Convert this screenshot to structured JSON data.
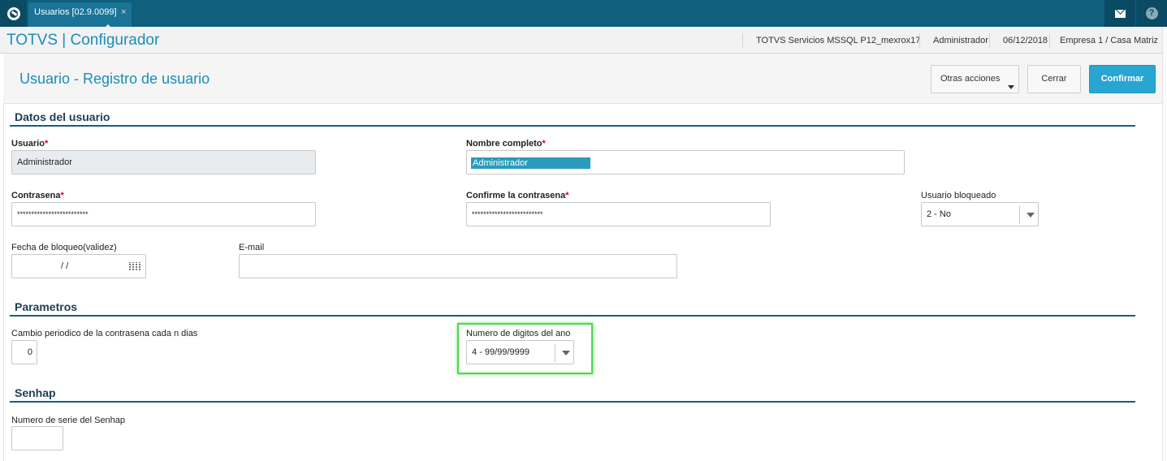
{
  "topbar": {
    "tab_label": "Usuarios [02.9.0099]",
    "tab_close": "×",
    "help_glyph": "?"
  },
  "header": {
    "brand": "TOTVS | Configurador",
    "server": "TOTVS Servicios MSSQL P12_mexrox17",
    "user": "Administrador",
    "date": "06/12/2018",
    "company": "Empresa 1 / Casa Matriz"
  },
  "page": {
    "title": "Usuario - Registro de usuario",
    "btn_more": "Otras acciones",
    "btn_close": "Cerrar",
    "btn_confirm": "Confirmar"
  },
  "user_section": {
    "title": "Datos del usuario",
    "usuario_label": "Usuario",
    "usuario_value": "Administrador",
    "nombre_label": "Nombre completo",
    "nombre_value": "Administrador",
    "contrasena_label": "Contrasena",
    "contrasena_value": "*************************",
    "confirme_label": "Confirme la contrasena",
    "confirme_value": "*************************",
    "bloqueado_label": "Usuario bloqueado",
    "bloqueado_value": "2 - No",
    "fecha_label": "Fecha de bloqueo(validez)",
    "fecha_value": "/ /",
    "email_label": "E-mail",
    "email_value": "",
    "required_mark": "*"
  },
  "param_section": {
    "title": "Parametros",
    "cambio_label": "Cambio periodico de la contrasena cada n dias",
    "cambio_value": "0",
    "digitos_label": "Numero de digitos del ano",
    "digitos_value": "4 - 99/99/9999"
  },
  "senhap_section": {
    "title": "Senhap",
    "serie_label": "Numero de serie del Senhap",
    "serie_value": ""
  },
  "colors": {
    "accent": "#1a8dbb",
    "topbar": "#0f5f7d",
    "primary_button": "#29a5d2",
    "highlight": "#4cd94c"
  }
}
